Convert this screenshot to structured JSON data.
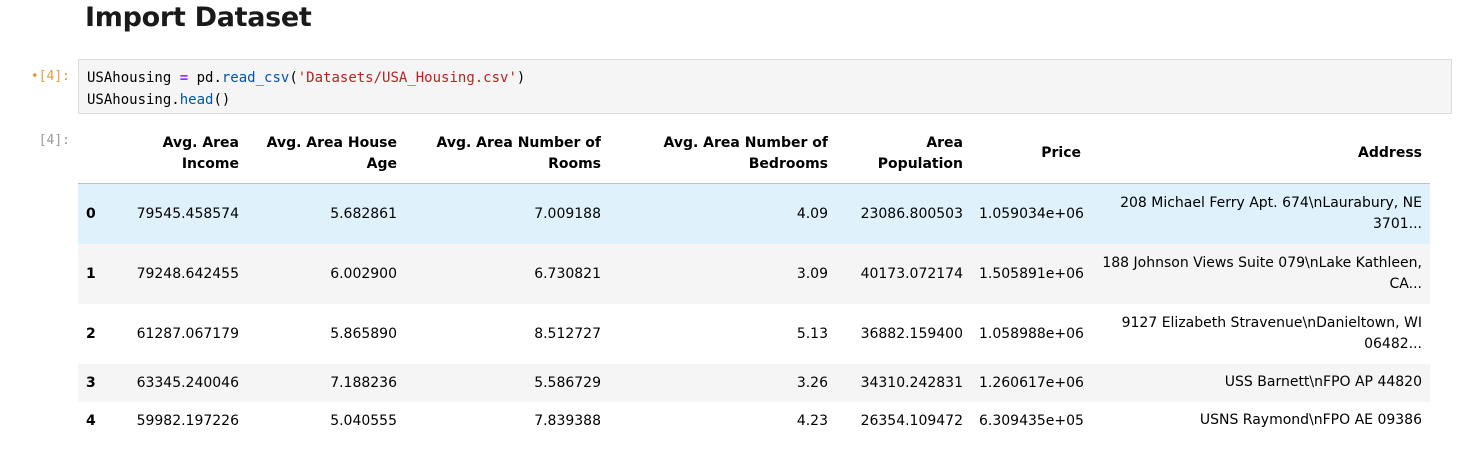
{
  "heading": "Import Dataset",
  "input_cell": {
    "prompt": "[4]:",
    "modified_marker": "•",
    "code_line1": {
      "var": "USAhousing ",
      "op": "=",
      "mid": " pd.",
      "fn": "read_csv",
      "open": "(",
      "str": "'Datasets/USA_Housing.csv'",
      "close": ")"
    },
    "code_line2": {
      "var": "USAhousing.",
      "fn": "head",
      "paren": "()"
    }
  },
  "output_cell": {
    "prompt": "[4]:"
  },
  "table": {
    "columns": [
      "",
      "Avg. Area Income",
      "Avg. Area House Age",
      "Avg. Area Number of Rooms",
      "Avg. Area Number of Bedrooms",
      "Area Population",
      "Price",
      "Address"
    ],
    "rows": [
      {
        "index": "0",
        "income": "79545.458574",
        "age": "5.682861",
        "rooms": "7.009188",
        "bedrooms": "4.09",
        "population": "23086.800503",
        "price": "1.059034e+06",
        "address": "208 Michael Ferry Apt. 674\\nLaurabury, NE 3701..."
      },
      {
        "index": "1",
        "income": "79248.642455",
        "age": "6.002900",
        "rooms": "6.730821",
        "bedrooms": "3.09",
        "population": "40173.072174",
        "price": "1.505891e+06",
        "address": "188 Johnson Views Suite 079\\nLake Kathleen, CA..."
      },
      {
        "index": "2",
        "income": "61287.067179",
        "age": "5.865890",
        "rooms": "8.512727",
        "bedrooms": "5.13",
        "population": "36882.159400",
        "price": "1.058988e+06",
        "address": "9127 Elizabeth Stravenue\\nDanieltown, WI 06482..."
      },
      {
        "index": "3",
        "income": "63345.240046",
        "age": "7.188236",
        "rooms": "5.586729",
        "bedrooms": "3.26",
        "population": "34310.242831",
        "price": "1.260617e+06",
        "address": "USS Barnett\\nFPO AP 44820"
      },
      {
        "index": "4",
        "income": "59982.197226",
        "age": "5.040555",
        "rooms": "7.839388",
        "bedrooms": "4.23",
        "population": "26354.109472",
        "price": "6.309435e+05",
        "address": "USNS Raymond\\nFPO AE 09386"
      }
    ]
  }
}
